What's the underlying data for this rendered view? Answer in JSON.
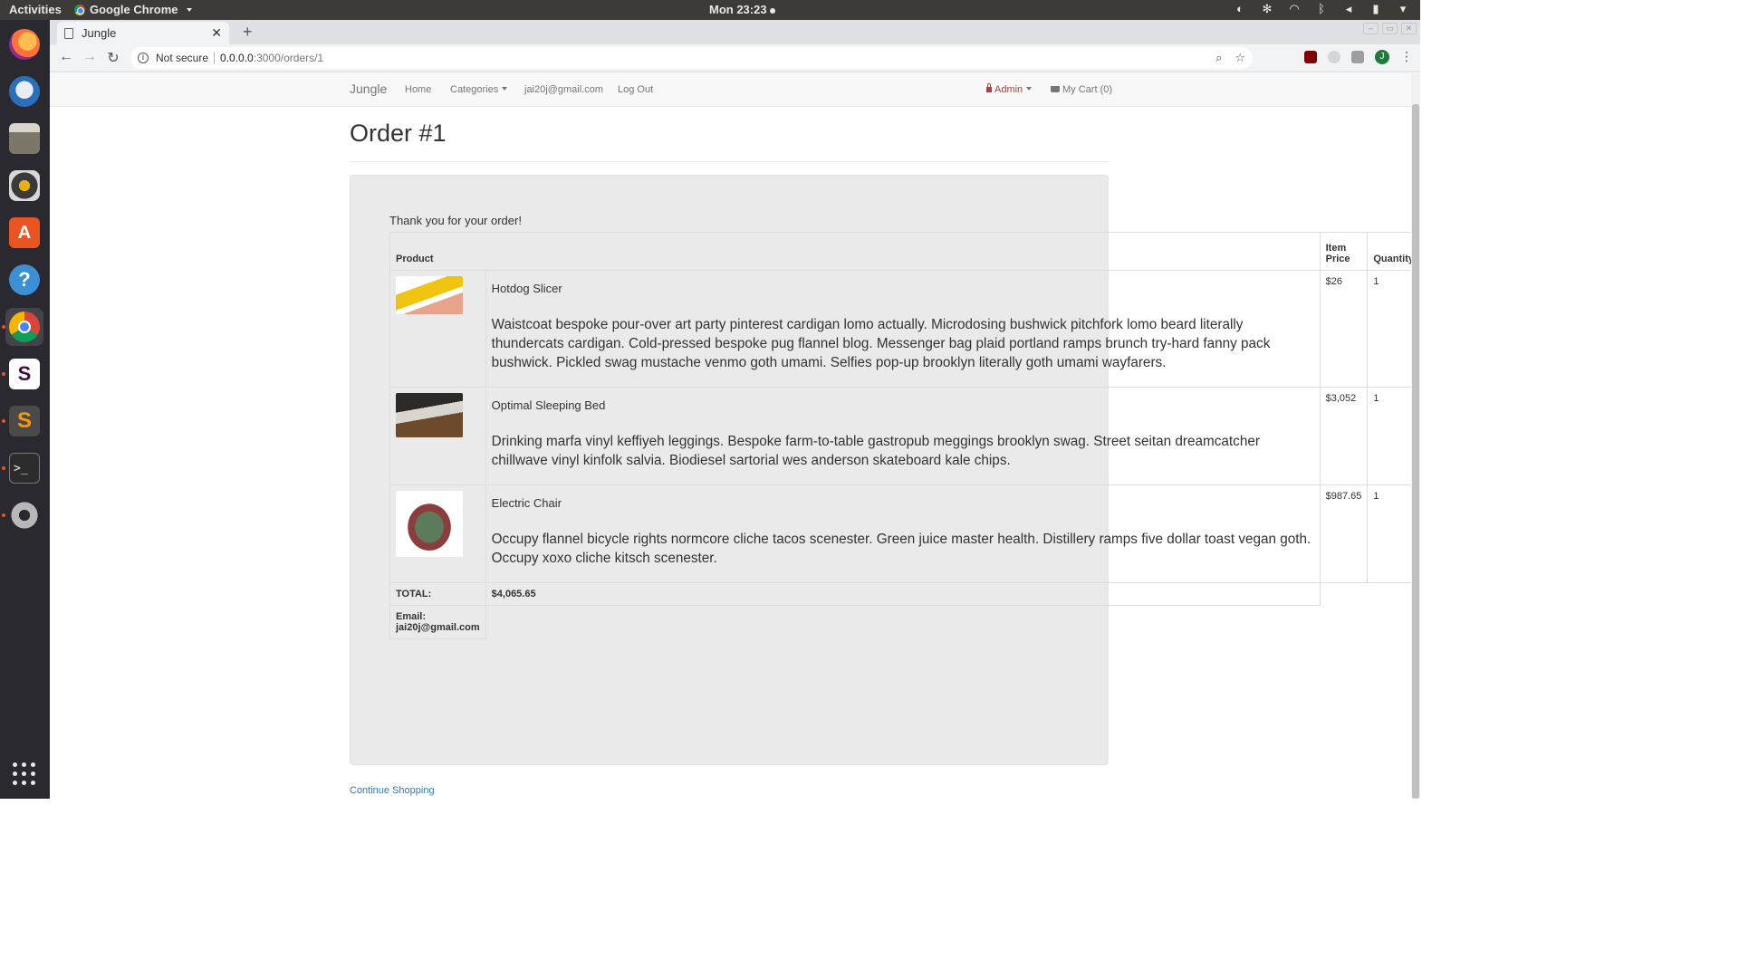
{
  "os": {
    "activities": "Activities",
    "app_name": "Google Chrome",
    "clock": "Mon 23:23"
  },
  "browser": {
    "tab_title": "Jungle",
    "security_label": "Not secure",
    "url_host": "0.0.0.0",
    "url_path": ":3000/orders/1"
  },
  "nav": {
    "brand": "Jungle",
    "home": "Home",
    "categories": "Categories",
    "user_email": "jai20j@gmail.com",
    "logout": "Log Out",
    "admin": "Admin",
    "cart": "My Cart (0)"
  },
  "page": {
    "title": "Order #1",
    "thanks": "Thank you for your order!",
    "continue": "Continue Shopping"
  },
  "table": {
    "headers": {
      "product": "Product",
      "item_price_1": "Item",
      "item_price_2": "Price",
      "quantity": "Quantity"
    },
    "items": [
      {
        "name": "Hotdog Slicer",
        "description": "Waistcoat bespoke pour-over art party pinterest cardigan lomo actually. Microdosing bushwick pitchfork lomo beard literally thundercats cardigan. Cold-pressed bespoke pug flannel blog. Messenger bag plaid portland ramps brunch try-hard fanny pack bushwick. Pickled swag mustache venmo goth umami. Selfies pop-up brooklyn literally goth umami wayfarers.",
        "price": "$26",
        "quantity": "1"
      },
      {
        "name": "Optimal Sleeping Bed",
        "description": "Drinking marfa vinyl keffiyeh leggings. Bespoke farm-to-table gastropub meggings brooklyn swag. Street seitan dreamcatcher chillwave vinyl kinfolk salvia. Biodiesel sartorial wes anderson skateboard kale chips.",
        "price": "$3,052",
        "quantity": "1"
      },
      {
        "name": "Electric Chair",
        "description": "Occupy flannel bicycle rights normcore cliche tacos scenester. Green juice master health. Distillery ramps five dollar toast vegan goth. Occupy xoxo cliche kitsch scenester.",
        "price": "$987.65",
        "quantity": "1"
      }
    ],
    "total_label": "TOTAL:",
    "total_value": "$4,065.65",
    "email_label": "Email:",
    "email_value": "jai20j@gmail.com"
  },
  "colors": {
    "link": "#337ab7",
    "admin": "#a94442",
    "well": "#eaeaea",
    "dock": "#2b2930"
  }
}
